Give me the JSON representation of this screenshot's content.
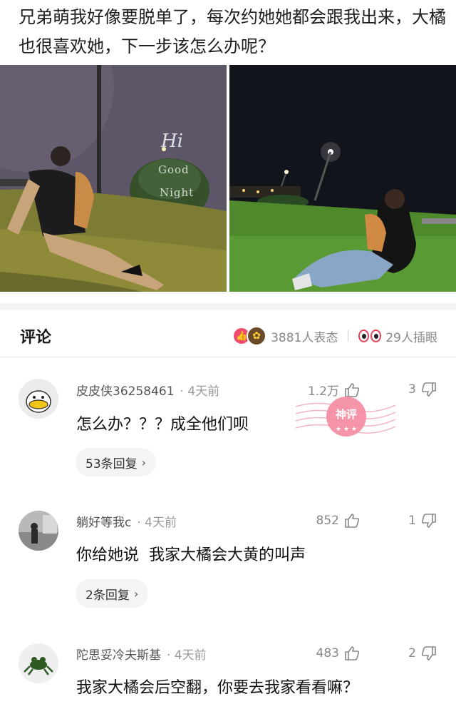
{
  "post": {
    "text": "兄弟萌我好像要脱单了，每次约她她都会跟我出来，大橘也很喜欢她，下一步该怎么办呢？",
    "images": [
      {
        "overlay_hi": "Hi",
        "overlay_good": "Good",
        "overlay_night": "Night"
      },
      {}
    ]
  },
  "comments_header": {
    "title": "评论",
    "reactions_text": "3881人表态",
    "poke_text": "29人插眼",
    "colors": {
      "like": "#f04a6e",
      "eye": "#e6435c"
    }
  },
  "comments": [
    {
      "username": "皮皮侠36258461",
      "time": "· 4天前",
      "likes": "1.2万",
      "dislikes": "3",
      "text": "怎么办？？？成全他们呗",
      "replies": "53条回复",
      "avatar_icon": "duck-avatar-icon"
    },
    {
      "username": "躺好等我c",
      "time": "· 4天前",
      "likes": "852",
      "dislikes": "1",
      "text": "你给她说  我家大橘会大黄的叫声",
      "replies": "2条回复",
      "avatar_icon": "photo-avatar-icon"
    },
    {
      "username": "陀思妥冷夫斯基",
      "time": "· 4天前",
      "likes": "483",
      "dislikes": "2",
      "text": "我家大橘会后空翻，你要去我家看看嘛？",
      "avatar_icon": "frog-avatar-icon"
    }
  ],
  "stamp": {
    "label": "神评"
  }
}
